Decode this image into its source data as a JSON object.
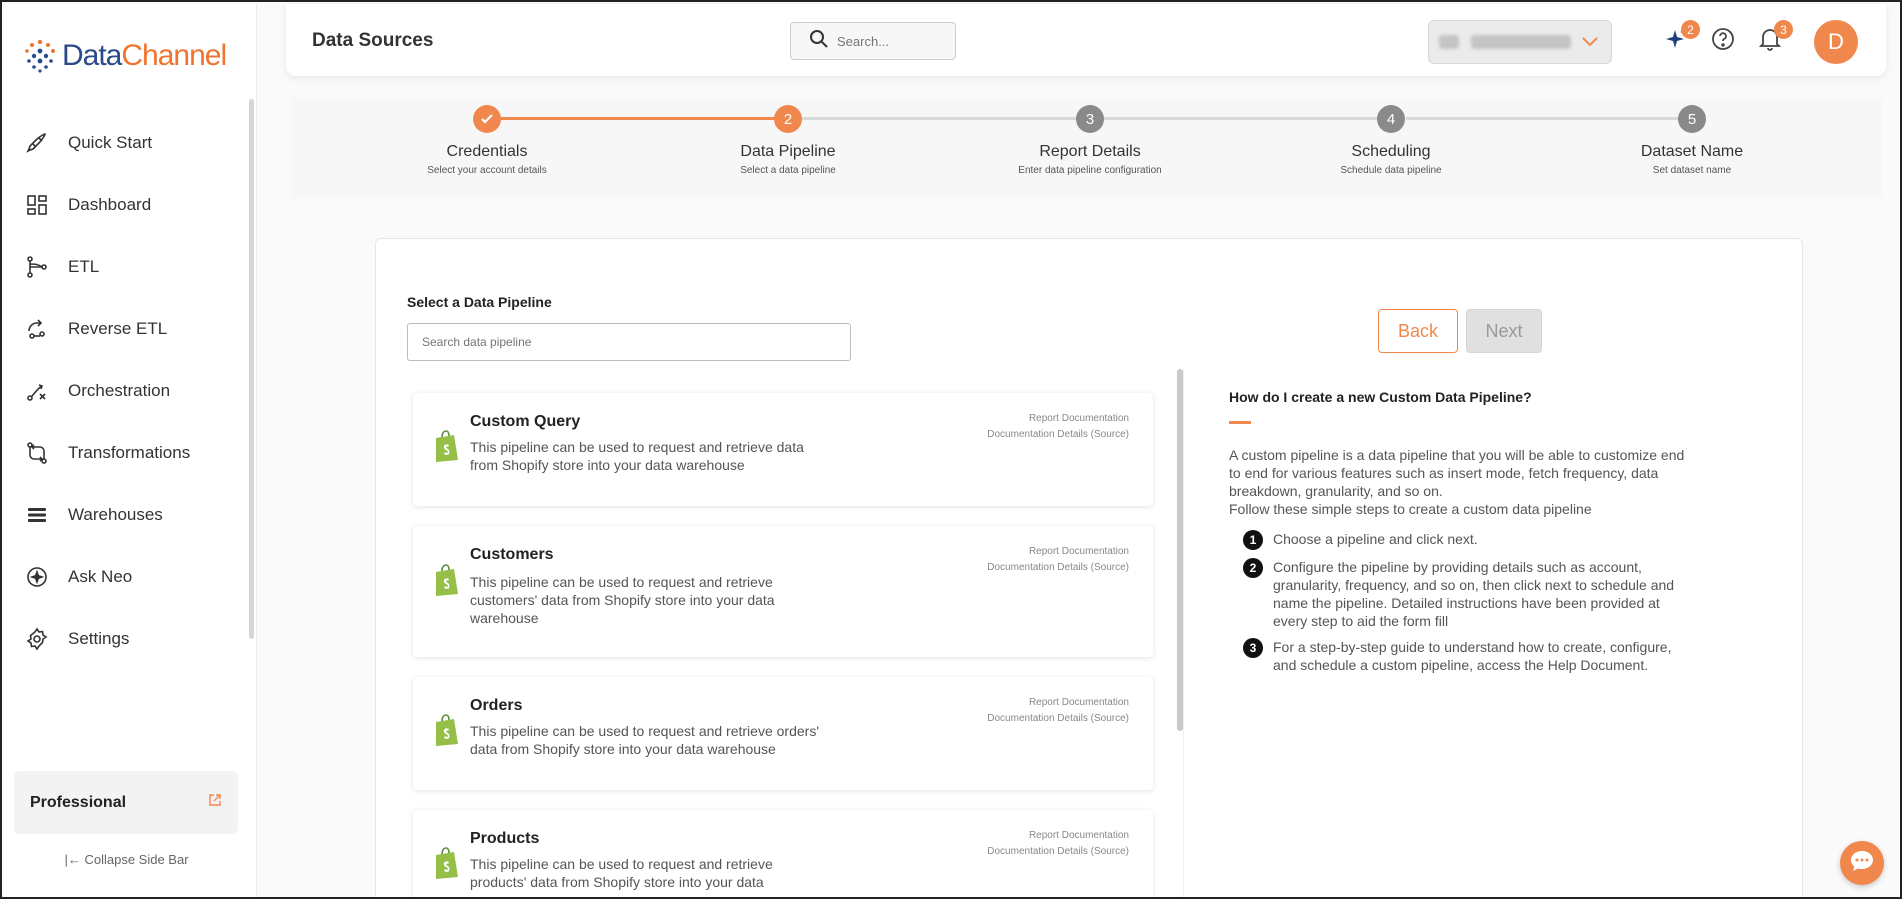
{
  "brand": {
    "name_part1": "Data",
    "name_part2": "Channel"
  },
  "sidebar": {
    "items": [
      {
        "label": "Quick Start",
        "icon": "rocket-icon"
      },
      {
        "label": "Dashboard",
        "icon": "dashboard-icon"
      },
      {
        "label": "ETL",
        "icon": "etl-icon"
      },
      {
        "label": "Reverse ETL",
        "icon": "reverse-etl-icon"
      },
      {
        "label": "Orchestration",
        "icon": "orchestration-icon"
      },
      {
        "label": "Transformations",
        "icon": "transformations-icon"
      },
      {
        "label": "Warehouses",
        "icon": "warehouses-icon"
      },
      {
        "label": "Ask Neo",
        "icon": "sparkle-icon"
      },
      {
        "label": "Settings",
        "icon": "gear-icon"
      }
    ],
    "plan": "Professional",
    "collapse_label": "Collapse Side Bar"
  },
  "header": {
    "title": "Data Sources",
    "search_placeholder": "Search...",
    "ai_badge": "2",
    "notif_badge": "3",
    "avatar_initial": "D"
  },
  "stepper": {
    "steps": [
      {
        "title": "Credentials",
        "subtitle": "Select your account details",
        "status": "done",
        "number": ""
      },
      {
        "title": "Data Pipeline",
        "subtitle": "Select a data pipeline",
        "status": "active",
        "number": "2"
      },
      {
        "title": "Report Details",
        "subtitle": "Enter data pipeline configuration",
        "status": "todo",
        "number": "3"
      },
      {
        "title": "Scheduling",
        "subtitle": "Schedule data pipeline",
        "status": "todo",
        "number": "4"
      },
      {
        "title": "Dataset Name",
        "subtitle": "Set dataset name",
        "status": "todo",
        "number": "5"
      }
    ]
  },
  "main": {
    "select_label": "Select a Data Pipeline",
    "search_placeholder": "Search data pipeline",
    "back_label": "Back",
    "next_label": "Next",
    "pipelines": [
      {
        "title": "Custom Query",
        "desc": "This pipeline can be used to request and retrieve data from Shopify store into your data warehouse",
        "link1": "Report Documentation",
        "link2": "Documentation Details (Source)"
      },
      {
        "title": "Customers",
        "desc": "This pipeline can be used to request and retrieve customers' data from Shopify store into your data warehouse",
        "link1": "Report Documentation",
        "link2": "Documentation Details (Source)"
      },
      {
        "title": "Orders",
        "desc": "This pipeline can be used to request and retrieve orders' data from Shopify store into your data warehouse",
        "link1": "Report Documentation",
        "link2": "Documentation Details (Source)"
      },
      {
        "title": "Products",
        "desc": "This pipeline can be used to request and retrieve products' data from Shopify store into your data",
        "link1": "Report Documentation",
        "link2": "Documentation Details (Source)"
      }
    ]
  },
  "help": {
    "title": "How do I create a new Custom Data Pipeline?",
    "intro": "A custom pipeline is a data pipeline that you will be able to customize end to end for various features such as insert mode, fetch frequency, data breakdown, granularity, and so on.",
    "intro2": "Follow these simple steps to create a custom data pipeline",
    "steps": [
      {
        "num": "1",
        "text": "Choose a pipeline and click next."
      },
      {
        "num": "2",
        "text": "Configure the pipeline by providing details such as account, granularity, frequency, and so on, then click next to schedule and name the pipeline. Detailed instructions have been provided at every step to aid the form fill"
      },
      {
        "num": "3",
        "text": "For a step-by-step guide to understand how to create, configure, and schedule a custom pipeline, access the Help Document."
      }
    ]
  },
  "colors": {
    "accent": "#f0884e",
    "brand_blue": "#2b4a8a",
    "shopify_green": "#95bf47",
    "step_grey": "#8a8a8a"
  }
}
